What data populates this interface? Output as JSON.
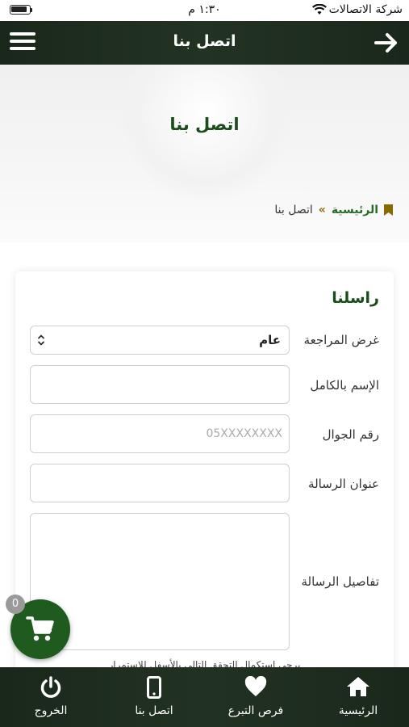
{
  "status_bar": {
    "time": "١:٣٠ م",
    "carrier": "شركة الاتصالات"
  },
  "header": {
    "title": "اتصل بنا"
  },
  "hero": {
    "title": "اتصل بنا"
  },
  "breadcrumb": {
    "home": "الرئيسية",
    "separator": "»",
    "current": "اتصل بنا"
  },
  "form": {
    "title": "راسلنا",
    "purpose": {
      "label": "غرض المراجعة",
      "value": "عام"
    },
    "full_name": {
      "label": "الإسم بالكامل",
      "value": "",
      "placeholder": ""
    },
    "mobile": {
      "label": "رقم الجوال",
      "value": "",
      "placeholder": "05XXXXXXXX"
    },
    "subject": {
      "label": "عنوان الرسالة",
      "value": "",
      "placeholder": ""
    },
    "details": {
      "label": "تفاصيل الرسالة",
      "value": ""
    },
    "note": "يرجى استكمال التحقق التالي بالأسفل للاستمرار"
  },
  "cart": {
    "count": "0"
  },
  "bottom_nav": {
    "items": [
      {
        "label": "الرئيسية",
        "icon": "home-icon"
      },
      {
        "label": "فرص التبرع",
        "icon": "heart-icon"
      },
      {
        "label": "اتصل بنا",
        "icon": "mobile-phone-icon"
      },
      {
        "label": "الخروج",
        "icon": "power-icon"
      }
    ]
  },
  "colors": {
    "header_bg": "#1d2a1d",
    "brand_green": "#1b4d1b",
    "cart_green": "#1f5a1f",
    "breadcrumb_separator": "#8a6a00"
  }
}
